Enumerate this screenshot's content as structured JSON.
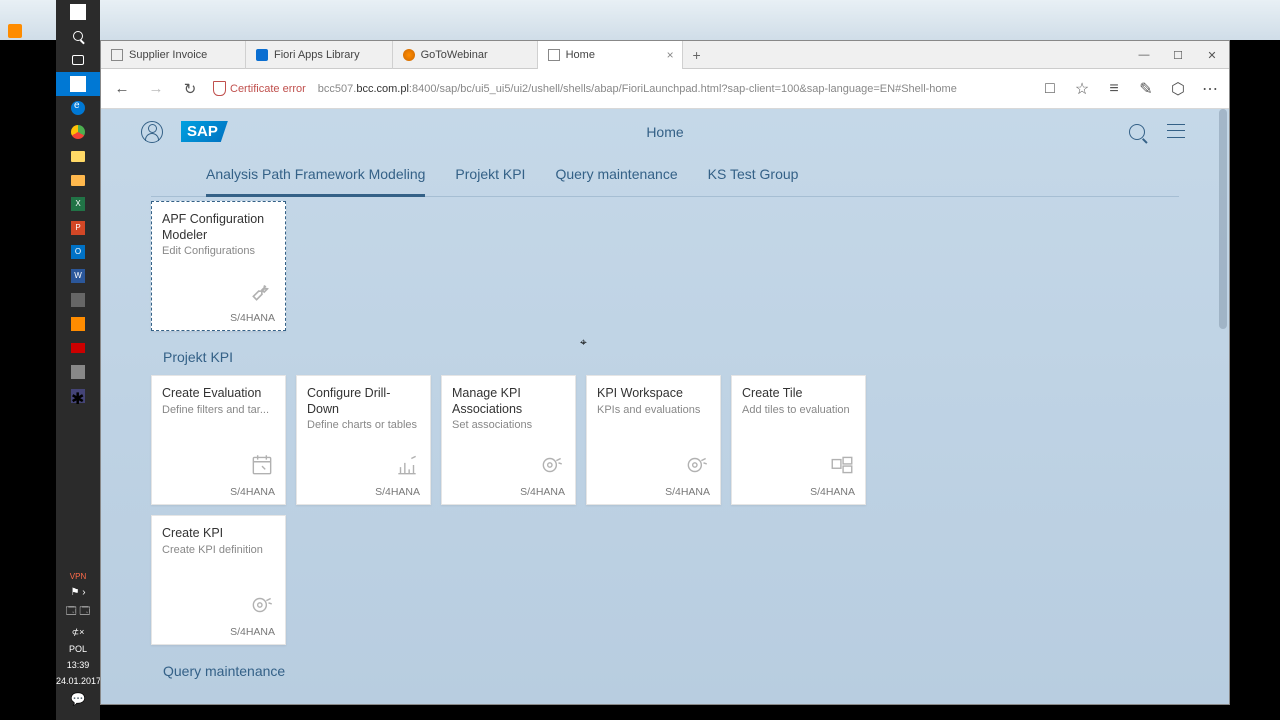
{
  "outer_window_controls": {
    "min": "_",
    "max": "□",
    "close": "✕"
  },
  "browser": {
    "tabs": [
      {
        "label": "Supplier Invoice",
        "active": false
      },
      {
        "label": "Fiori Apps Library",
        "active": false
      },
      {
        "label": "GoToWebinar",
        "active": false
      },
      {
        "label": "Home",
        "active": true
      }
    ],
    "new_tab": "+",
    "window_controls": {
      "min": "—",
      "max": "☐",
      "close": "✕"
    },
    "nav": {
      "back": "←",
      "forward": "→",
      "refresh": "↻"
    },
    "cert_error": "Certificate error",
    "url_host": "bcc.com.pl",
    "url_prefix": "bcc507.",
    "url_rest": ":8400/sap/bc/ui5_ui5/ui2/ushell/shells/abap/FioriLaunchpad.html?sap-client=100&sap-language=EN#Shell-home",
    "addr_icons": {
      "read": "□",
      "star": "☆",
      "hub": "≡",
      "notes": "✎",
      "share": "⬡",
      "more": "⋯"
    }
  },
  "shell": {
    "logo": "SAP",
    "title": "Home"
  },
  "groups": {
    "tabs": [
      "Analysis Path Framework Modeling",
      "Projekt KPI",
      "Query maintenance",
      "KS Test Group"
    ],
    "active": 0
  },
  "apf_tile": {
    "title": "APF Configuration Modeler",
    "subtitle": "Edit Configurations",
    "footer": "S/4HANA"
  },
  "projekt_kpi": {
    "title": "Projekt KPI",
    "tiles": [
      {
        "title": "Create Evaluation",
        "subtitle": "Define filters and tar...",
        "footer": "S/4HANA",
        "icon": "calendar"
      },
      {
        "title": "Configure Drill-Down",
        "subtitle": "Define charts or tables",
        "footer": "S/4HANA",
        "icon": "chart"
      },
      {
        "title": "Manage KPI Associations",
        "subtitle": "Set associations",
        "footer": "S/4HANA",
        "icon": "target"
      },
      {
        "title": "KPI Workspace",
        "subtitle": "KPIs and evaluations",
        "footer": "S/4HANA",
        "icon": "target"
      },
      {
        "title": "Create Tile",
        "subtitle": "Add tiles to evaluation",
        "footer": "S/4HANA",
        "icon": "tile"
      }
    ],
    "tiles_row2": [
      {
        "title": "Create KPI",
        "subtitle": "Create KPI definition",
        "footer": "S/4HANA",
        "icon": "target"
      }
    ]
  },
  "query_maintenance_title": "Query maintenance",
  "taskbar": {
    "vpn": "VPN",
    "vol": "⊄×",
    "lang": "POL",
    "time": "13:39",
    "date": "24.01.2017"
  }
}
